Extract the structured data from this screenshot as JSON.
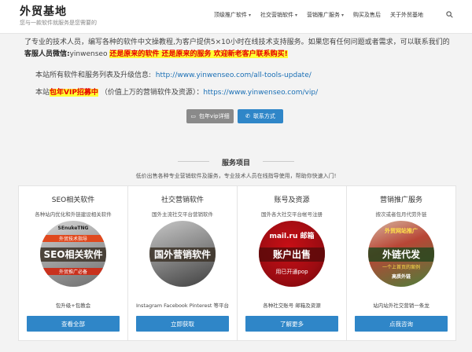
{
  "header": {
    "logo_title": "外贸基地",
    "logo_subtitle": "您与一款软件就服务是您需要的",
    "nav": [
      {
        "label": "顶级推广软件",
        "caret": true
      },
      {
        "label": "社交营销软件",
        "caret": true
      },
      {
        "label": "营销推广服务",
        "caret": true
      },
      {
        "label": "购买及售后",
        "caret": false
      },
      {
        "label": "关于外贸基地",
        "caret": false
      }
    ],
    "search_icon": "search-icon"
  },
  "intro": {
    "line1": "了专业的技术人员，编写各种的软件中文操教程,为客户提供5×10小时在线技术支持服务。如果您有任何问题或者需求，可以联系我们的",
    "wechat_label": "客服人员微信:",
    "wechat_id": "yinwenseo",
    "highlight": "还是原来的软件 还是原来的服务 欢迎新老客户联系购买!",
    "list_text": "本站所有软件和服务列表及升级信息:",
    "list_url": "http://www.yinwenseo.com/all-tools-update/",
    "vip_prefix": "本站",
    "vip_highlight": "包年VIP招募中",
    "vip_text": "（价值上万的营销软件及资源）：",
    "vip_url": "https://www.yinwenseo.com/vip/"
  },
  "buttons": {
    "vip_details": "包年vip详细",
    "contact": "联系方式"
  },
  "services": {
    "title": "服务项目",
    "description": "低价出售各种专业营销软件及服务，专业技术人员在线指导使用，帮助你快速入门!",
    "cards": [
      {
        "title": "SEO相关软件",
        "subtitle": "各种站内优化和外链建设相关软件",
        "badge": "SEO相关软件",
        "desc": "包升级+包教会",
        "button": "查看全部",
        "img_text_1": "SEnukeTNG",
        "img_text_2": "外贸技术指导",
        "img_text_3": "外贸推广必备"
      },
      {
        "title": "社交营销软件",
        "subtitle": "国外主流社交平台营销软件",
        "badge": "国外营销软件",
        "desc": "Instagram Facebook Pinterest 等平台",
        "button": "立即获取",
        "img_text_1": "",
        "img_text_2": "",
        "img_text_3": ""
      },
      {
        "title": "账号及资源",
        "subtitle": "国外各大社交平台帐号注册",
        "badge": "账户出售",
        "desc": "各种社交账号 邮箱及资源",
        "button": "了解更多",
        "img_text_1": "mail.ru 邮箱",
        "img_text_2": "",
        "img_text_3": "用已开通pop"
      },
      {
        "title": "营销推广服务",
        "subtitle": "按次或者包月代劳外链",
        "badge": "外链代发",
        "desc": "站内站外社交营销一条龙",
        "button": "点我咨询",
        "img_text_1": "外贸网站推广",
        "img_text_2": "一个上首页的案例",
        "img_text_3": "高质外链"
      }
    ]
  }
}
